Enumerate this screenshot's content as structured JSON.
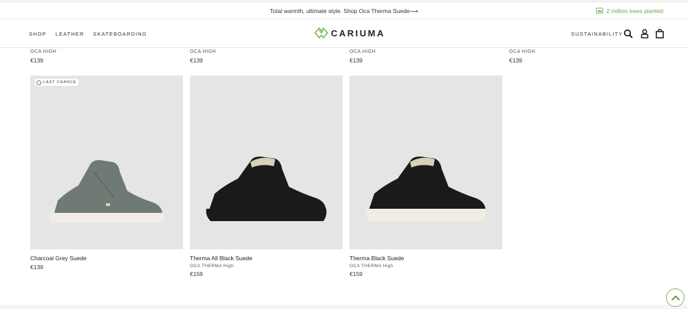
{
  "promo": {
    "text": "Total warmth, ultimate style. Shop Oca Therma Suede⟶"
  },
  "trees": {
    "text": "2 million trees planted"
  },
  "nav": {
    "links": [
      "SHOP",
      "LEATHER",
      "SKATEBOARDING"
    ],
    "logo": "CARIUMA",
    "right_link": "SUSTAINABILITY",
    "icons": [
      "search-icon",
      "account-icon",
      "bag-icon"
    ]
  },
  "previous_row": [
    {
      "subtitle": "OCA HIGH",
      "price": "€139"
    },
    {
      "subtitle": "OCA HIGH",
      "price": "€139"
    },
    {
      "subtitle": "OCA HIGH",
      "price": "€139"
    },
    {
      "subtitle": "OCA HIGH",
      "price": "€139"
    }
  ],
  "products": [
    {
      "badge": "LAST CHANCE",
      "name": "Charcoal Grey Suede",
      "price": "€139",
      "color": "#6f7a74",
      "sole": "#f0ede4"
    },
    {
      "name": "Therma All Black Suede",
      "sub_model": "OCA THERMA",
      "sub_height": "High",
      "price": "€159",
      "color": "#1a1a1a",
      "sole": "#1a1a1a"
    },
    {
      "name": "Therma Black Suede",
      "sub_model": "OCA THERMA",
      "sub_height": "High",
      "price": "€159",
      "color": "#1a1a1a",
      "sole": "#f0ede4"
    }
  ],
  "colors": {
    "accent": "#6aa84f",
    "image_bg": "#e5e5e5"
  }
}
